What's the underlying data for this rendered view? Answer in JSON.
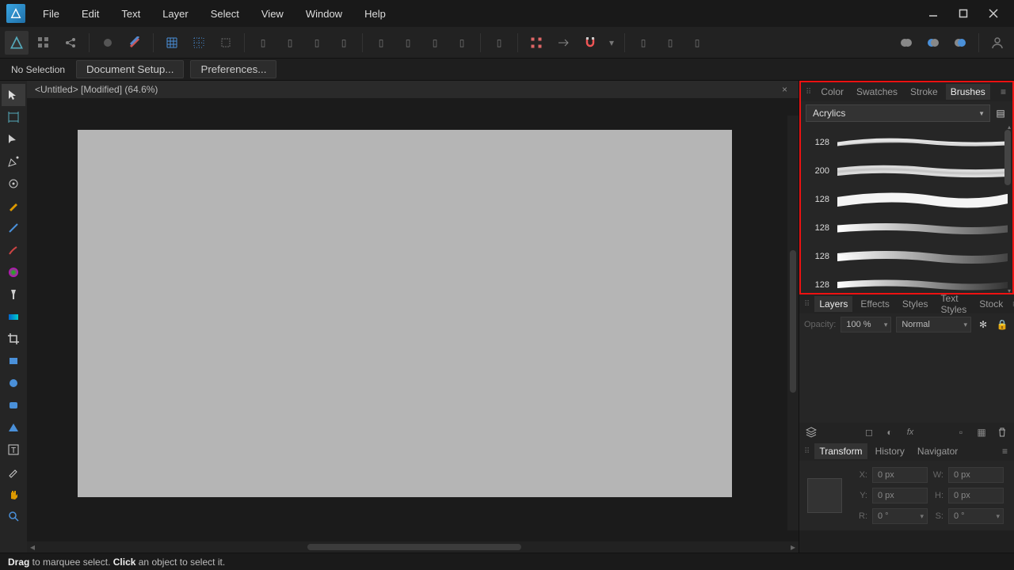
{
  "menu": {
    "items": [
      "File",
      "Edit",
      "Text",
      "Layer",
      "Select",
      "View",
      "Window",
      "Help"
    ]
  },
  "optbar": {
    "no_selection": "No Selection",
    "doc_setup": "Document Setup...",
    "prefs": "Preferences..."
  },
  "doc": {
    "title": "<Untitled> [Modified] (64.6%)"
  },
  "panels": {
    "color_tabs": [
      "Color",
      "Swatches",
      "Stroke",
      "Brushes"
    ],
    "color_active": 3,
    "brush_category": "Acrylics",
    "brushes": [
      {
        "size": "128"
      },
      {
        "size": "200"
      },
      {
        "size": "128"
      },
      {
        "size": "128"
      },
      {
        "size": "128"
      },
      {
        "size": "128"
      }
    ],
    "layer_tabs": [
      "Layers",
      "Effects",
      "Styles",
      "Text Styles",
      "Stock"
    ],
    "layer_active": 0,
    "opacity_label": "Opacity:",
    "opacity_value": "100 %",
    "blend_mode": "Normal",
    "transform_tabs": [
      "Transform",
      "History",
      "Navigator"
    ],
    "transform_active": 0,
    "tf": {
      "x_lbl": "X:",
      "x": "0 px",
      "w_lbl": "W:",
      "w": "0 px",
      "y_lbl": "Y:",
      "y": "0 px",
      "h_lbl": "H:",
      "h": "0 px",
      "r_lbl": "R:",
      "r": "0 °",
      "s_lbl": "S:",
      "s": "0 °"
    }
  },
  "status": {
    "drag": "Drag",
    "drag_rest": " to marquee select. ",
    "click": "Click",
    "click_rest": " an object to select it."
  }
}
